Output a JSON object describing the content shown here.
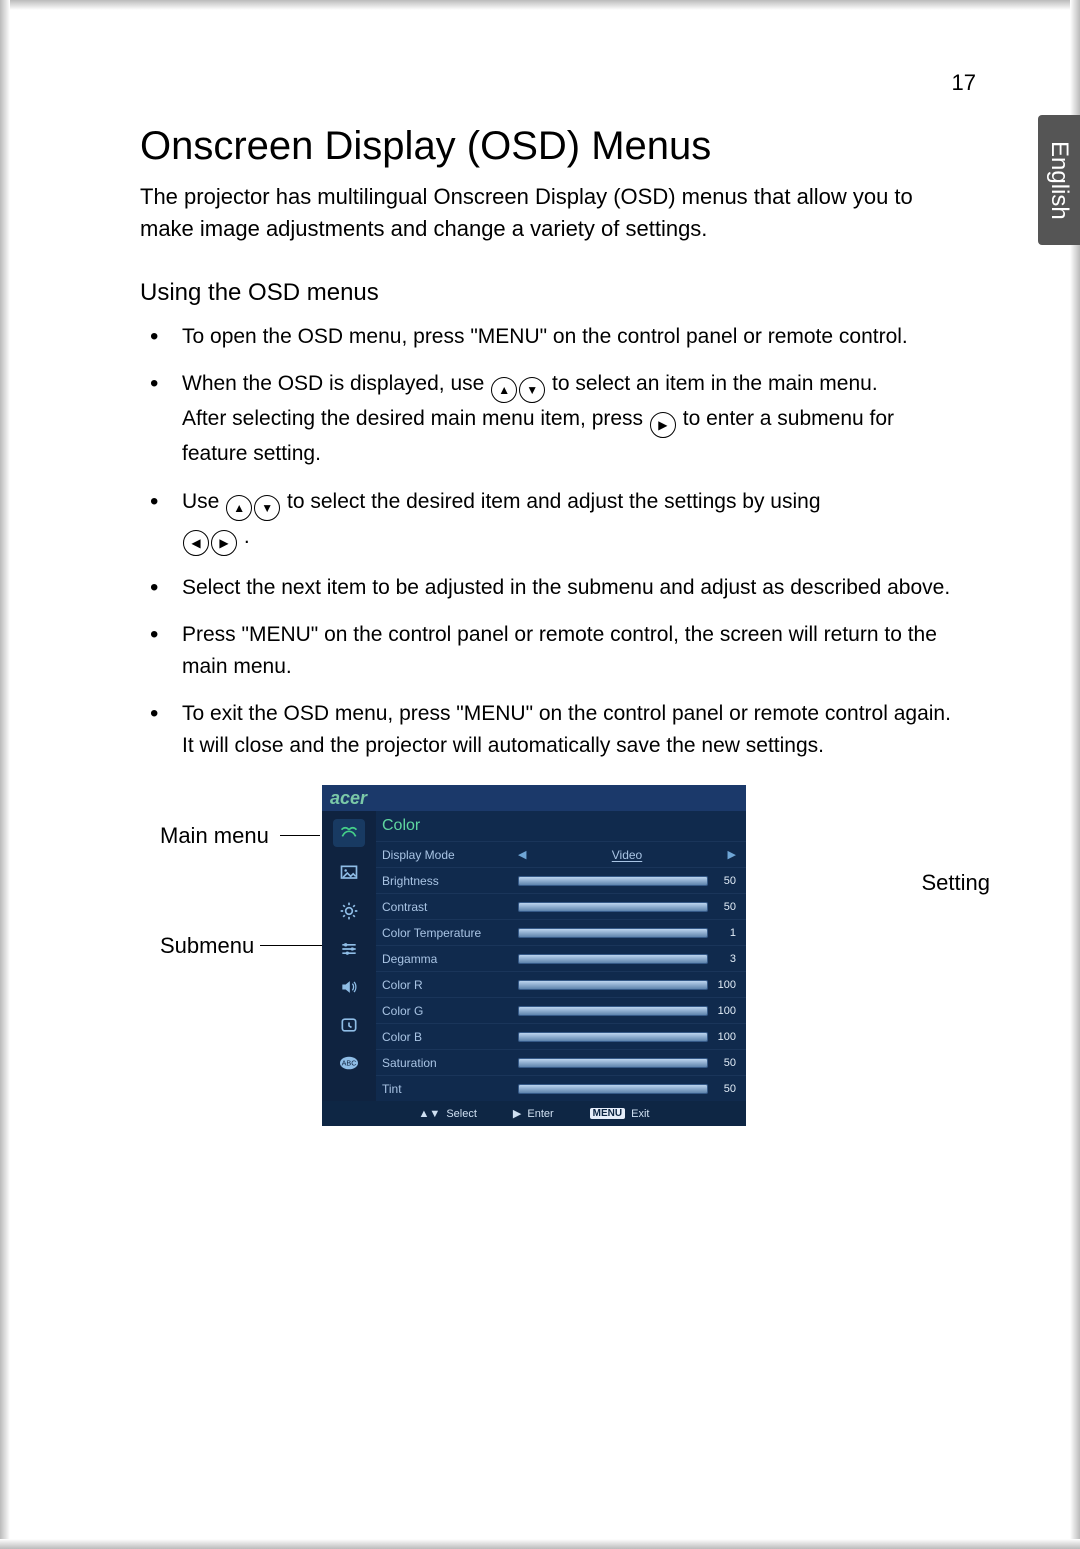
{
  "page_number": "17",
  "language_tab": "English",
  "heading": "Onscreen Display (OSD) Menus",
  "intro": "The projector has multilingual Onscreen Display (OSD) menus that allow you to make image adjustments and change a variety of settings.",
  "subheading": "Using the OSD menus",
  "bullets": {
    "b1": "To open the OSD menu, press \"MENU\" on the control panel or remote control.",
    "b2a": "When the OSD is displayed, use ",
    "b2b": " to select an item in the main menu.",
    "b2c": "After selecting the desired main menu item, press ",
    "b2d": " to enter a submenu for feature setting.",
    "b3a": "Use ",
    "b3b": " to select the desired item and adjust the settings by using ",
    "b3c": ".",
    "b4": "Select the next item to be adjusted in the submenu and adjust as described above.",
    "b5": "Press \"MENU\" on the control panel or remote control, the screen will return to the main menu.",
    "b6": "To exit the OSD menu, press \"MENU\" on the control panel or remote control again. It will close and the projector will automatically save the new settings."
  },
  "callouts": {
    "main": "Main menu",
    "sub": "Submenu",
    "setting": "Setting"
  },
  "osd": {
    "brand": "acer",
    "title": "Color",
    "rows": [
      {
        "label": "Display Mode",
        "type": "select",
        "value": "Video"
      },
      {
        "label": "Brightness",
        "type": "slider",
        "value": "50"
      },
      {
        "label": "Contrast",
        "type": "slider",
        "value": "50"
      },
      {
        "label": "Color Temperature",
        "type": "slider",
        "value": "1"
      },
      {
        "label": "Degamma",
        "type": "slider",
        "value": "3"
      },
      {
        "label": "Color R",
        "type": "slider",
        "value": "100"
      },
      {
        "label": "Color G",
        "type": "slider",
        "value": "100"
      },
      {
        "label": "Color B",
        "type": "slider",
        "value": "100"
      },
      {
        "label": "Saturation",
        "type": "slider",
        "value": "50"
      },
      {
        "label": "Tint",
        "type": "slider",
        "value": "50"
      }
    ],
    "footer": {
      "select": "Select",
      "enter": "Enter",
      "menu": "MENU",
      "exit": "Exit"
    }
  }
}
